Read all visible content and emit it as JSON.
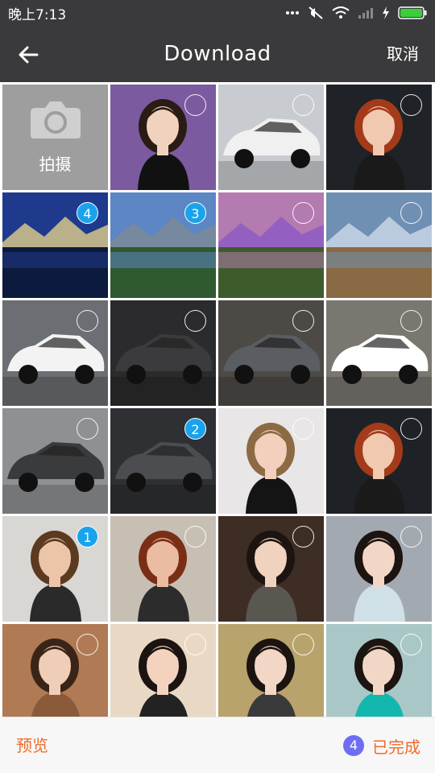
{
  "status_bar": {
    "time": "晚上7:13"
  },
  "header": {
    "title": "Download",
    "cancel": "取消"
  },
  "camera_tile": {
    "label": "拍摄"
  },
  "grid": [
    {
      "kind": "person",
      "bg": "#7b5aa0",
      "skin": "#f0d2bf",
      "hair": "#2a1b14",
      "cloth": "#111111",
      "selected": null
    },
    {
      "kind": "car",
      "bg": "#c8ccd0",
      "car": "#f0f0f0",
      "selected": null
    },
    {
      "kind": "person",
      "bg": "#1f2327",
      "skin": "#f1c8b0",
      "hair": "#a33a1a",
      "cloth": "#1a1a1a",
      "selected": null
    },
    {
      "kind": "landscape",
      "sky": "#1f3a8c",
      "land": "#0c1a3d",
      "accent": "#d6c58a",
      "selected": "4"
    },
    {
      "kind": "landscape",
      "sky": "#5c86c4",
      "land": "#2f5a2f",
      "accent": "#7a8a99",
      "selected": "3"
    },
    {
      "kind": "landscape",
      "sky": "#b47bb0",
      "land": "#3e5b2c",
      "accent": "#8d5cc4",
      "selected": null
    },
    {
      "kind": "landscape",
      "sky": "#6f8fb3",
      "land": "#8a6a44",
      "accent": "#c9d6e6",
      "selected": null
    },
    {
      "kind": "car",
      "bg": "#6b6e72",
      "car": "#f3f3f3",
      "selected": null
    },
    {
      "kind": "car",
      "bg": "#2b2b2d",
      "car": "#3b3b3e",
      "selected": null
    },
    {
      "kind": "car",
      "bg": "#4d4a46",
      "car": "#5a5d62",
      "selected": null
    },
    {
      "kind": "car",
      "bg": "#7a7670",
      "car": "#ffffff",
      "selected": null
    },
    {
      "kind": "car",
      "bg": "#8e9092",
      "car": "#3a3b3d",
      "selected": null
    },
    {
      "kind": "car",
      "bg": "#2e3033",
      "car": "#4b4d50",
      "selected": "2"
    },
    {
      "kind": "person",
      "bg": "#e8e6e6",
      "skin": "#f2d0bd",
      "hair": "#8c6a44",
      "cloth": "#141414",
      "selected": null
    },
    {
      "kind": "person",
      "bg": "#1e2226",
      "skin": "#f1c8b0",
      "hair": "#a33a1a",
      "cloth": "#1a1a1a",
      "selected": null
    },
    {
      "kind": "person",
      "bg": "#d9d7d4",
      "skin": "#ecc4aa",
      "hair": "#5c3a20",
      "cloth": "#2a2a2a",
      "selected": "1"
    },
    {
      "kind": "person",
      "bg": "#c7bfb3",
      "skin": "#eabca2",
      "hair": "#7a2e16",
      "cloth": "#2c2c2c",
      "selected": null
    },
    {
      "kind": "person",
      "bg": "#3e2d24",
      "skin": "#f0d2bf",
      "hair": "#1c1410",
      "cloth": "#5a5650",
      "selected": null
    },
    {
      "kind": "person",
      "bg": "#a3a9b0",
      "skin": "#f2d6c6",
      "hair": "#1c1410",
      "cloth": "#cfe0e6",
      "selected": null
    },
    {
      "kind": "person",
      "bg": "#b07a54",
      "skin": "#f0cdb6",
      "hair": "#3a2418",
      "cloth": "#8a5a3a",
      "selected": null
    },
    {
      "kind": "person",
      "bg": "#e9d9c4",
      "skin": "#f3d3bd",
      "hair": "#1c1410",
      "cloth": "#222222",
      "selected": null
    },
    {
      "kind": "person",
      "bg": "#b8a36c",
      "skin": "#f2d6c6",
      "hair": "#1c1410",
      "cloth": "#3a3a3a",
      "selected": null
    },
    {
      "kind": "person",
      "bg": "#a9c7c6",
      "skin": "#f2d6c6",
      "hair": "#1c1410",
      "cloth": "#14b7ad",
      "selected": null
    }
  ],
  "footer": {
    "preview": "预览",
    "done_count": "4",
    "done": "已完成"
  },
  "colors": {
    "accent": "#f06a2b",
    "bar": "#3a3a3c",
    "badge": "#1aa3ec",
    "count_badge": "#6e6ef2"
  },
  "icons": [
    "back-arrow-icon",
    "camera-icon",
    "wifi-icon",
    "signal-icon",
    "battery-icon",
    "more-dots-icon",
    "mute-icon",
    "charging-icon"
  ]
}
